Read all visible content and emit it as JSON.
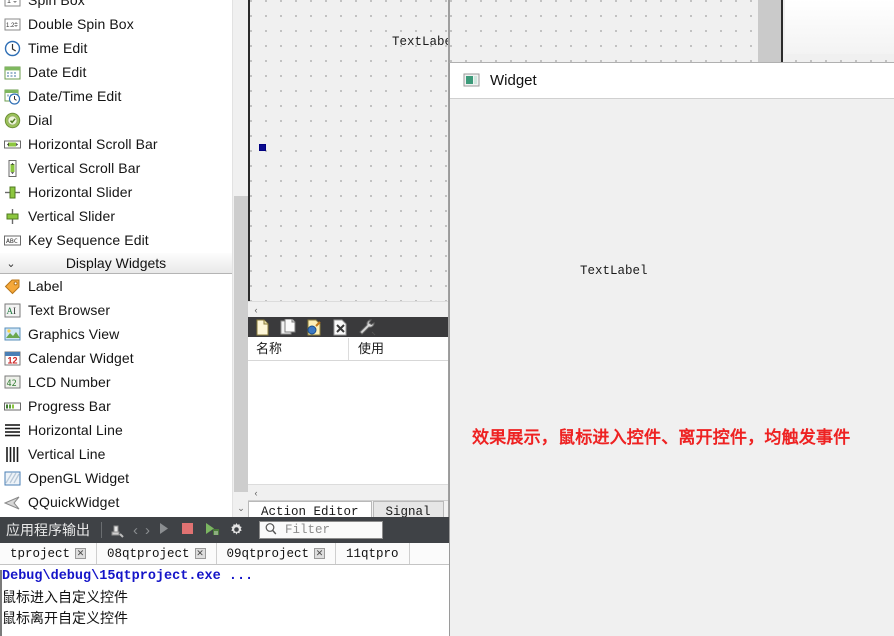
{
  "widget_box": {
    "items": [
      {
        "label": "Spin Box",
        "icon": "spinbox-icon"
      },
      {
        "label": "Double Spin Box",
        "icon": "double-spinbox-icon"
      },
      {
        "label": "Time Edit",
        "icon": "time-edit-icon"
      },
      {
        "label": "Date Edit",
        "icon": "date-edit-icon"
      },
      {
        "label": "Date/Time Edit",
        "icon": "date-time-edit-icon"
      },
      {
        "label": "Dial",
        "icon": "dial-icon"
      },
      {
        "label": "Horizontal Scroll Bar",
        "icon": "horizontal-scrollbar-icon"
      },
      {
        "label": "Vertical Scroll Bar",
        "icon": "vertical-scrollbar-icon"
      },
      {
        "label": "Horizontal Slider",
        "icon": "horizontal-slider-icon"
      },
      {
        "label": "Vertical Slider",
        "icon": "vertical-slider-icon"
      },
      {
        "label": "Key Sequence Edit",
        "icon": "key-sequence-edit-icon"
      }
    ],
    "group": {
      "label": "Display Widgets",
      "chevron": "⌄"
    },
    "display_items": [
      {
        "label": "Label",
        "icon": "label-icon"
      },
      {
        "label": "Text Browser",
        "icon": "text-browser-icon"
      },
      {
        "label": "Graphics View",
        "icon": "graphics-view-icon"
      },
      {
        "label": "Calendar Widget",
        "icon": "calendar-widget-icon"
      },
      {
        "label": "LCD Number",
        "icon": "lcd-number-icon"
      },
      {
        "label": "Progress Bar",
        "icon": "progress-bar-icon"
      },
      {
        "label": "Horizontal Line",
        "icon": "horizontal-line-icon"
      },
      {
        "label": "Vertical Line",
        "icon": "vertical-line-icon"
      },
      {
        "label": "OpenGL Widget",
        "icon": "opengl-widget-icon"
      },
      {
        "label": "QQuickWidget",
        "icon": "qquickwidget-icon"
      }
    ],
    "scroll_down_arrow": "⌄"
  },
  "canvas": {
    "text_label": "TextLabel",
    "scroll_left_arrow": "‹"
  },
  "action_editor": {
    "toolbar": [
      {
        "name": "new-action-icon"
      },
      {
        "name": "copy-action-icon"
      },
      {
        "name": "edit-action-icon"
      },
      {
        "name": "delete-action-icon"
      },
      {
        "name": "configure-icon"
      }
    ],
    "columns": [
      "名称",
      "使用"
    ],
    "scroll_left_arrow": "‹",
    "tabs": [
      {
        "label": "Action Editor",
        "active": true
      },
      {
        "label": "Signal",
        "active": false
      }
    ]
  },
  "widget_window": {
    "title": "Widget",
    "icon": "widget-window-icon",
    "text_label": "TextLabel",
    "note": "效果展示，鼠标进入控件、离开控件，均触发事件",
    "note_color": "#ee2222"
  },
  "output_pane": {
    "title": "应用程序输出",
    "tools": [
      {
        "name": "clear-output-icon"
      },
      {
        "name": "prev-item-icon",
        "glyph": "‹"
      },
      {
        "name": "next-item-icon",
        "glyph": "›"
      },
      {
        "name": "run-icon"
      },
      {
        "name": "stop-icon"
      },
      {
        "name": "debug-run-icon"
      },
      {
        "name": "settings-gear-icon"
      }
    ],
    "filter_placeholder": "Filter",
    "filter_value": "",
    "tabs": [
      {
        "label": "tproject",
        "closable": true
      },
      {
        "label": "08qtproject",
        "closable": true
      },
      {
        "label": "09qtproject",
        "closable": true
      },
      {
        "label": "11qtpro",
        "closable": false
      }
    ],
    "log_lines": [
      {
        "text": "Debug\\debug\\15qtproject.exe ...",
        "style": "debug"
      },
      {
        "text": "鼠标进入自定义控件",
        "style": "cn"
      },
      {
        "text": "鼠标离开自定义控件",
        "style": "cn"
      }
    ]
  }
}
